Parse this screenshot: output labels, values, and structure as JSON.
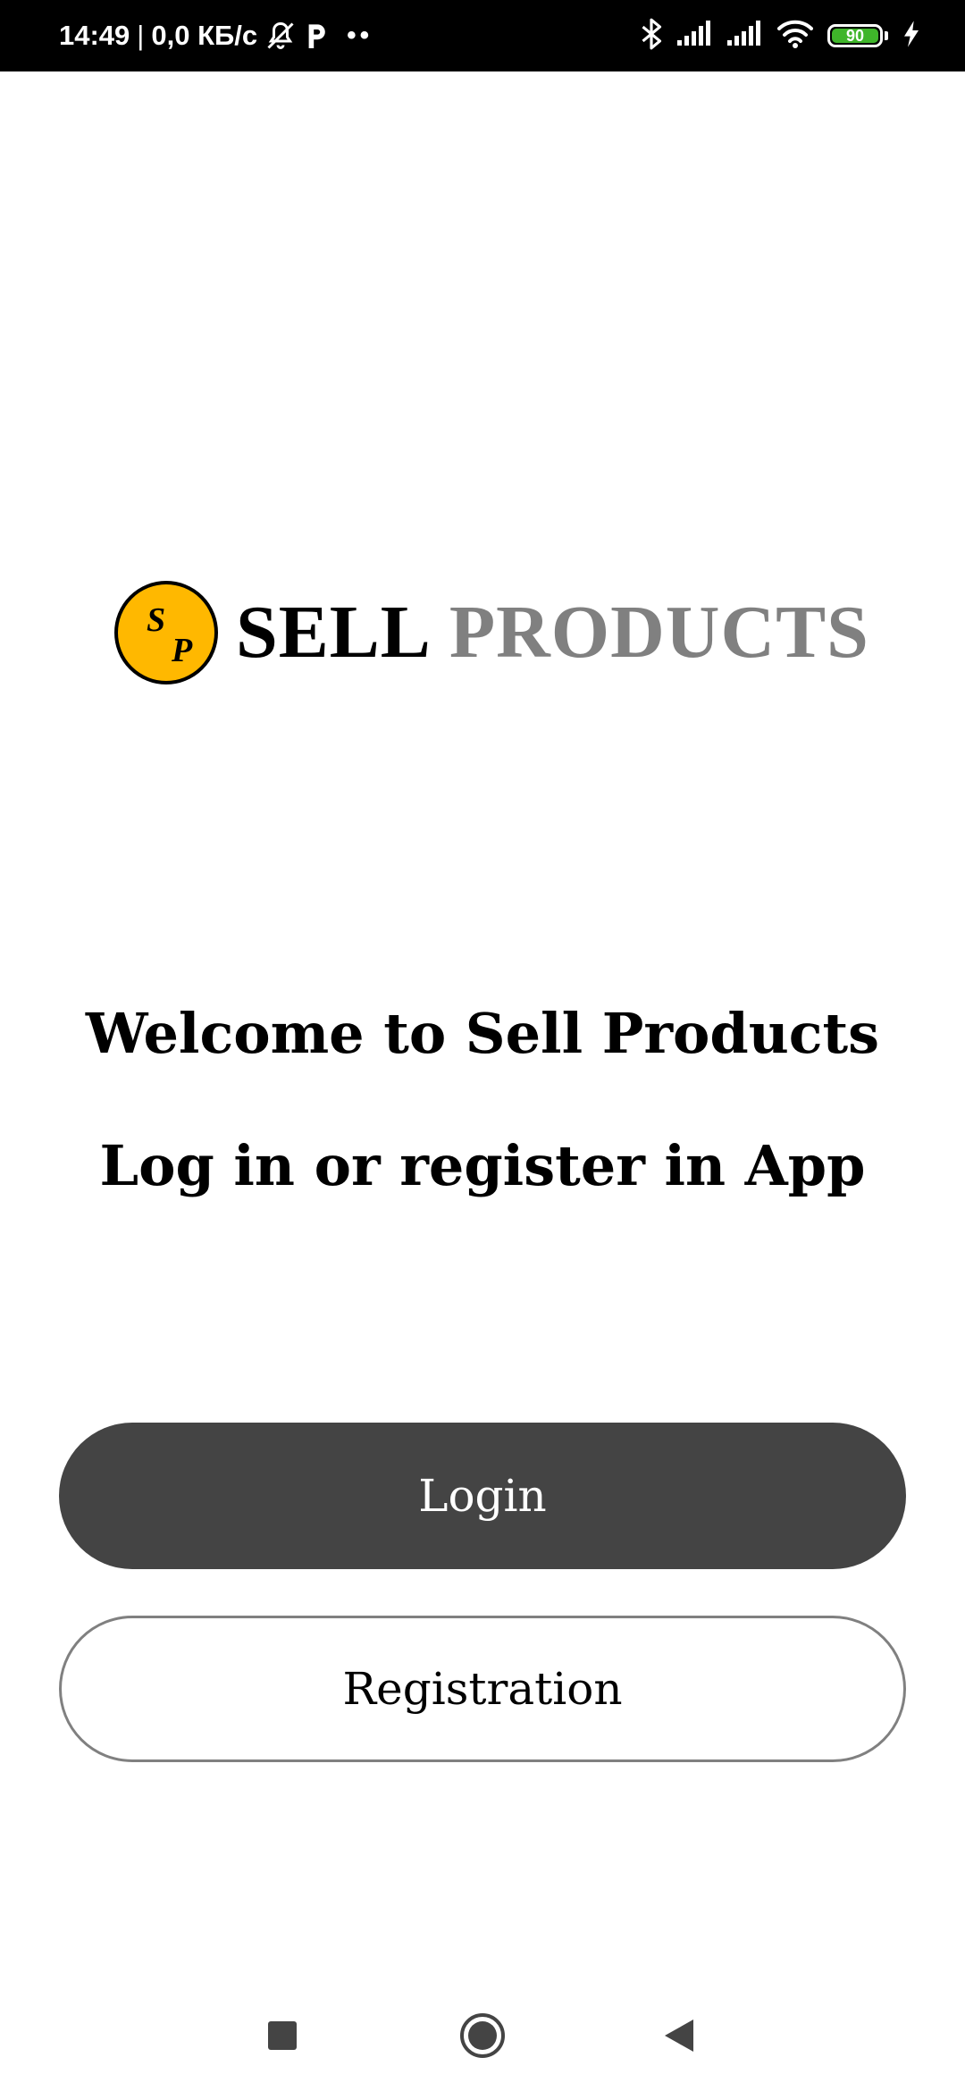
{
  "status_bar": {
    "time": "14:49",
    "separator": "|",
    "network_speed": "0,0 КБ/с",
    "overflow_dots": "••",
    "battery_level": "90",
    "icons": [
      "bell-off-icon",
      "parking-icon",
      "bluetooth-icon",
      "signal-icon",
      "signal-icon",
      "wifi-icon",
      "battery-icon",
      "charging-icon"
    ]
  },
  "logo": {
    "monogram_top": "S",
    "monogram_bottom": "P",
    "word_1": "SELL",
    "word_2": "PRODUCTS",
    "colors": {
      "circle": "#ffb800",
      "word_1": "#000000",
      "word_2": "#808080"
    }
  },
  "welcome": {
    "title": "Welcome to Sell Products",
    "subtitle": "Log in or register in App"
  },
  "buttons": {
    "login_label": "Login",
    "registration_label": "Registration",
    "colors": {
      "login_bg": "#444444",
      "registration_border": "#808080"
    }
  },
  "nav_bar": {
    "icons": [
      "recents-icon",
      "home-icon",
      "back-icon"
    ]
  }
}
